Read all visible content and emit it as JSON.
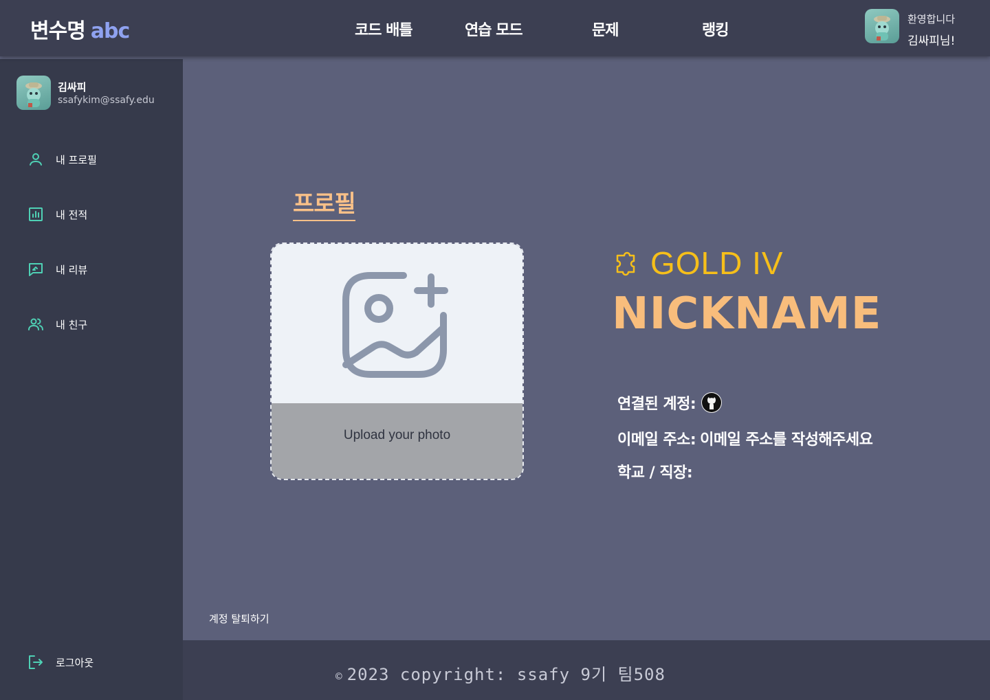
{
  "header": {
    "logo_main": "변수명",
    "logo_accent": "abc",
    "nav": [
      "코드 배틀",
      "연습 모드",
      "문제",
      "랭킹"
    ],
    "welcome": "환영합니다",
    "greeting": "김싸피님!"
  },
  "sidebar": {
    "user_name": "김싸피",
    "user_email": "ssafykim@ssafy.edu",
    "items": [
      {
        "label": "내 프로필",
        "icon": "user-icon"
      },
      {
        "label": "내 전적",
        "icon": "chart-icon"
      },
      {
        "label": "내 리뷰",
        "icon": "review-icon"
      },
      {
        "label": "내 친구",
        "icon": "friends-icon"
      }
    ],
    "logout": "로그아웃"
  },
  "profile": {
    "title": "프로필",
    "upload_label": "Upload your photo",
    "tier": "GOLD IV",
    "nickname": "NICKNAME",
    "linked_label": "연결된 계정:",
    "email_label": "이메일 주소:",
    "email_value": "이메일 주소를 작성해주세요",
    "school_label": "학교 / 직장:",
    "school_value": ""
  },
  "withdraw": "계정 탈퇴하기",
  "footer": {
    "copyright_symbol": "©",
    "copyright": "2023 copyright: ssafy 9기 팀508"
  },
  "colors": {
    "accent_teal": "#4fd1b5",
    "tier_gold": "#f6bf1a",
    "nickname_orange": "#f8bd7c",
    "logo_blue": "#8fa2f0"
  }
}
